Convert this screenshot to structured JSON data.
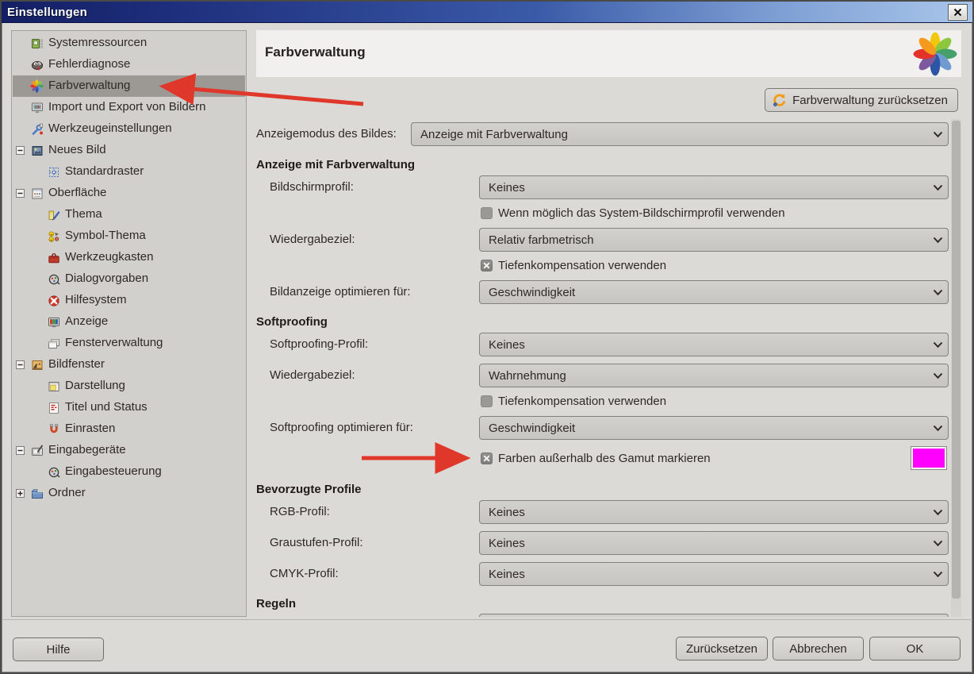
{
  "window": {
    "title": "Einstellungen",
    "close": "X"
  },
  "sidebar": {
    "items": [
      {
        "label": "Systemressourcen",
        "icon": "system-resources",
        "level": 1
      },
      {
        "label": "Fehlerdiagnose",
        "icon": "wilber-debug",
        "level": 1
      },
      {
        "label": "Farbverwaltung",
        "icon": "color-flower",
        "level": 1,
        "selected": true
      },
      {
        "label": "Import und Export von Bildern",
        "icon": "import-export",
        "level": 1
      },
      {
        "label": "Werkzeugeinstellungen",
        "icon": "tool-options",
        "level": 1
      },
      {
        "label": "Neues Bild",
        "icon": "new-image",
        "level": 1,
        "expander": "minus"
      },
      {
        "label": "Standardraster",
        "icon": "grid",
        "level": 2
      },
      {
        "label": "Oberfläche",
        "icon": "interface-window",
        "level": 1,
        "expander": "minus"
      },
      {
        "label": "Thema",
        "icon": "theme-palette",
        "level": 2
      },
      {
        "label": "Symbol-Thema",
        "icon": "icon-theme-faces",
        "level": 2
      },
      {
        "label": "Werkzeugkasten",
        "icon": "toolbox",
        "level": 2
      },
      {
        "label": "Dialogvorgaben",
        "icon": "dialog-defaults",
        "level": 2
      },
      {
        "label": "Hilfesystem",
        "icon": "help-lifebuoy",
        "level": 2
      },
      {
        "label": "Anzeige",
        "icon": "display-monitor",
        "level": 2
      },
      {
        "label": "Fensterverwaltung",
        "icon": "window-management",
        "level": 2
      },
      {
        "label": "Bildfenster",
        "icon": "image-window",
        "level": 1,
        "expander": "minus"
      },
      {
        "label": "Darstellung",
        "icon": "appearance-window",
        "level": 2
      },
      {
        "label": "Titel und Status",
        "icon": "title-status",
        "level": 2
      },
      {
        "label": "Einrasten",
        "icon": "snap-magnet",
        "level": 2
      },
      {
        "label": "Eingabegeräte",
        "icon": "input-devices",
        "level": 1,
        "expander": "minus"
      },
      {
        "label": "Eingabesteuerung",
        "icon": "input-controllers",
        "level": 2
      },
      {
        "label": "Ordner",
        "icon": "folders",
        "level": 1,
        "expander": "plus"
      }
    ]
  },
  "header": {
    "title": "Farbverwaltung"
  },
  "reset_button": {
    "label": "Farbverwaltung zurücksetzen",
    "icon": "reset-icon"
  },
  "form": {
    "rows": [
      {
        "type": "dropdown",
        "label": "Anzeigemodus des Bildes:",
        "value": "Anzeige mit Farbverwaltung",
        "wide": true
      },
      {
        "type": "section",
        "label": "Anzeige mit Farbverwaltung"
      },
      {
        "type": "dropdown",
        "label": "Bildschirmprofil:",
        "value": "Keines"
      },
      {
        "type": "checkbox",
        "label": "Wenn möglich das System-Bildschirmprofil verwenden",
        "checked": false
      },
      {
        "type": "dropdown",
        "label": "Wiedergabeziel:",
        "value": "Relativ farbmetrisch"
      },
      {
        "type": "checkbox",
        "label": "Tiefenkompensation verwenden",
        "checked": true
      },
      {
        "type": "dropdown",
        "label": "Bildanzeige optimieren für:",
        "value": "Geschwindigkeit"
      },
      {
        "type": "section",
        "label": "Softproofing"
      },
      {
        "type": "dropdown",
        "label": "Softproofing-Profil:",
        "value": "Keines"
      },
      {
        "type": "dropdown",
        "label": "Wiedergabeziel:",
        "value": "Wahrnehmung"
      },
      {
        "type": "checkbox",
        "label": "Tiefenkompensation verwenden",
        "checked": false
      },
      {
        "type": "dropdown",
        "label": "Softproofing optimieren für:",
        "value": "Geschwindigkeit"
      },
      {
        "type": "checkbox",
        "label": "Farben außerhalb des Gamut markieren",
        "checked": true,
        "swatch": "#ff00ff"
      },
      {
        "type": "section",
        "label": "Bevorzugte Profile"
      },
      {
        "type": "dropdown",
        "label": "RGB-Profil:",
        "value": "Keines"
      },
      {
        "type": "dropdown",
        "label": "Graustufen-Profil:",
        "value": "Keines"
      },
      {
        "type": "dropdown",
        "label": "CMYK-Profil:",
        "value": "Keines"
      },
      {
        "type": "section",
        "label": "Regeln"
      },
      {
        "type": "dropdown-partial"
      }
    ]
  },
  "footer": {
    "help": "Hilfe",
    "reset": "Zurücksetzen",
    "cancel": "Abbrechen",
    "ok": "OK"
  },
  "colors": {
    "gamut_swatch": "#ff00ff",
    "annotation_arrow": "#e0372b",
    "titlebar_left": "#141f63",
    "titlebar_right": "#a9c6ea",
    "selected_row": "#9c9995",
    "flower_petals": [
      "#f2c80f",
      "#8dc63f",
      "#46a06a",
      "#6f9bd1",
      "#2d55a5",
      "#7d5a9e",
      "#e23229",
      "#f59a1d"
    ]
  }
}
